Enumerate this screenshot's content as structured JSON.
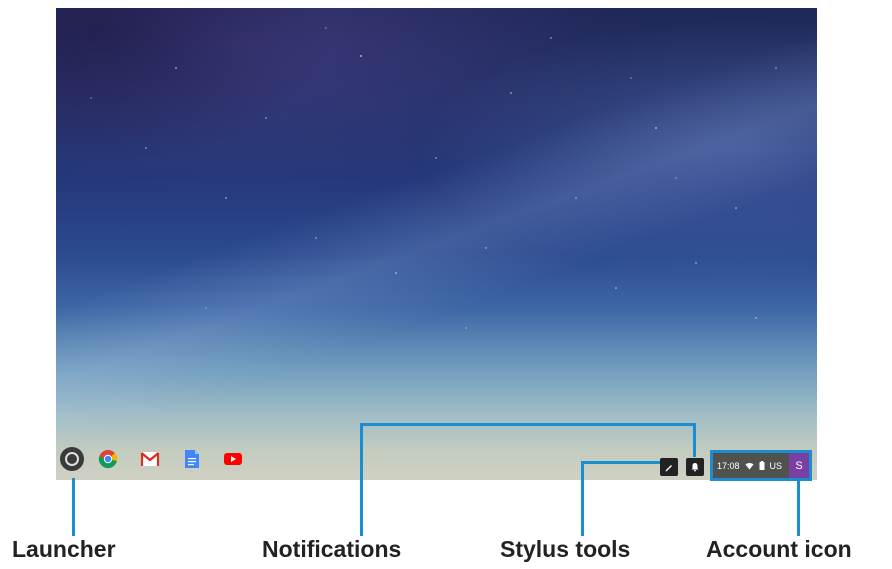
{
  "shelf": {
    "apps": [
      {
        "name": "chrome-icon"
      },
      {
        "name": "gmail-icon"
      },
      {
        "name": "docs-icon"
      },
      {
        "name": "youtube-icon"
      }
    ]
  },
  "status_tray": {
    "time": "17:08",
    "locale": "US",
    "account_initial": "S"
  },
  "annotations": {
    "launcher": "Launcher",
    "notifications": "Notifications",
    "stylus_tools": "Stylus tools",
    "account_icon": "Account icon"
  },
  "colors": {
    "callout": "#1a8ed1",
    "account": "#7a3fa3"
  }
}
